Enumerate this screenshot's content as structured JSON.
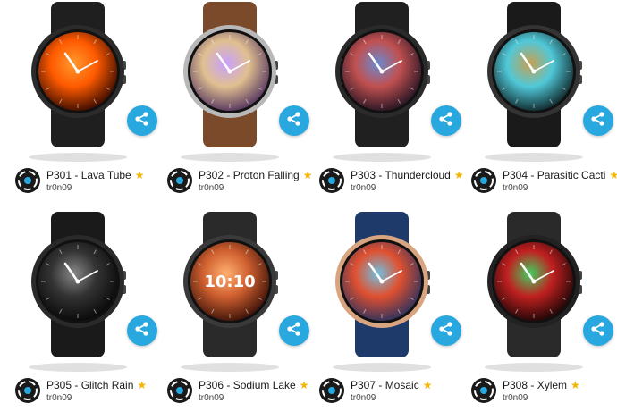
{
  "watchfaces": [
    {
      "title": "P301 - Lava Tube",
      "author": "tr0n09",
      "face": "lava"
    },
    {
      "title": "P302 - Proton Falling",
      "author": "tr0n09",
      "face": "proton"
    },
    {
      "title": "P303 - Thundercloud",
      "author": "tr0n09",
      "face": "thunder"
    },
    {
      "title": "P304 - Parasitic Cacti",
      "author": "tr0n09",
      "face": "cacti"
    },
    {
      "title": "P305 - Glitch Rain",
      "author": "tr0n09",
      "face": "glitch"
    },
    {
      "title": "P306 - Sodium Lake",
      "author": "tr0n09",
      "face": "sodium",
      "time": "10:10"
    },
    {
      "title": "P307 - Mosaic",
      "author": "tr0n09",
      "face": "mosaic"
    },
    {
      "title": "P308 - Xylem",
      "author": "tr0n09",
      "face": "xylem"
    }
  ],
  "colors": {
    "share_button": "#29a8e0",
    "star": "#f4b400"
  },
  "icons": {
    "share": "share-icon",
    "favorite": "star-icon",
    "avatar": "author-avatar-icon"
  }
}
